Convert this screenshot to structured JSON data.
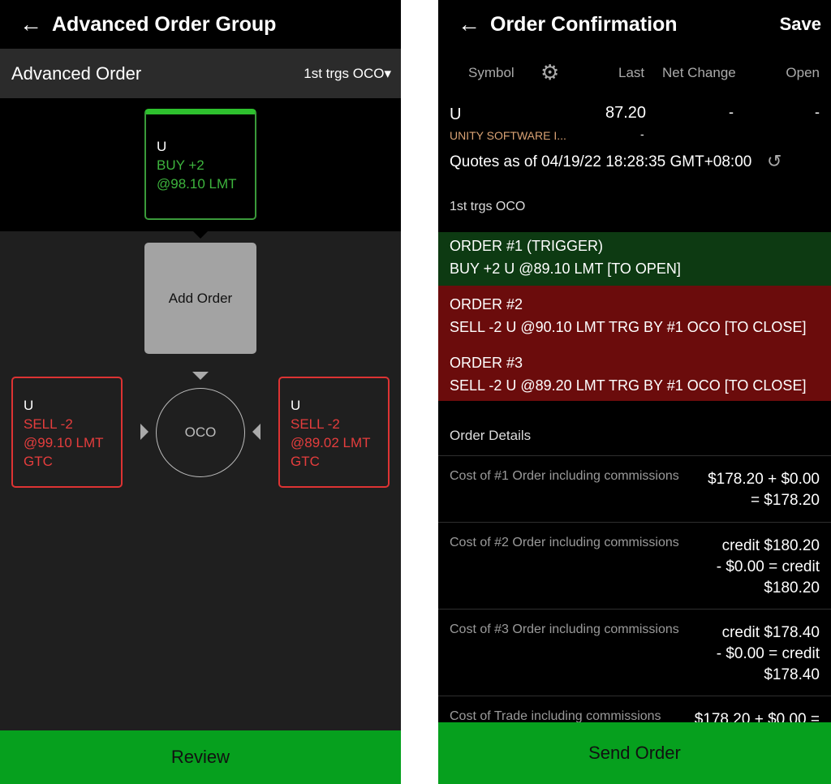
{
  "left": {
    "title": "Advanced Order Group",
    "subheader": {
      "label": "Advanced Order",
      "dropdown": "1st trgs OCO"
    },
    "trigger_order": {
      "symbol": "U",
      "action": "BUY +2",
      "price": "@98.10 LMT"
    },
    "add_order_label": "Add Order",
    "oco_label": "OCO",
    "oco_left": {
      "symbol": "U",
      "action": "SELL -2",
      "price": "@99.10 LMT",
      "tif": "GTC"
    },
    "oco_right": {
      "symbol": "U",
      "action": "SELL -2",
      "price": "@89.02 LMT",
      "tif": "GTC"
    },
    "review_label": "Review"
  },
  "right": {
    "title": "Order Confirmation",
    "save_label": "Save",
    "columns": [
      "Symbol",
      "Last",
      "Net Change",
      "Open"
    ],
    "quote": {
      "symbol": "U",
      "name": "UNITY SOFTWARE I...",
      "last": "87.20",
      "last_sub": "-",
      "net_change": "-",
      "open": "-"
    },
    "quotes_as_of": "Quotes as of 04/19/22 18:28:35 GMT+08:00",
    "group_type": "1st trgs OCO",
    "orders": [
      {
        "title": "ORDER #1 (TRIGGER)",
        "desc": "BUY +2 U @89.10 LMT [TO OPEN]"
      },
      {
        "title": "ORDER #2",
        "desc": "SELL -2 U @90.10 LMT TRG BY #1 OCO [TO CLOSE]"
      },
      {
        "title": "ORDER #3",
        "desc": "SELL -2 U @89.20 LMT TRG BY #1 OCO [TO CLOSE]"
      }
    ],
    "details_label": "Order Details",
    "costs": [
      {
        "label": "Cost of #1 Order including commissions",
        "value": "$178.20 + $0.00 = $178.20"
      },
      {
        "label": "Cost of #2 Order including commissions",
        "value": "credit $180.20 - $0.00 = credit $180.20"
      },
      {
        "label": "Cost of #3 Order including commissions",
        "value": "credit $178.40 - $0.00 = credit $178.40"
      },
      {
        "label": "Cost of Trade including commissions",
        "value": "$178.20 + $0.00 ="
      }
    ],
    "send_label": "Send Order"
  },
  "colors": {
    "green": "#06a01e",
    "buy": "#3db43d",
    "sell": "#e53d3d",
    "trigger_bg": "#0d3a12",
    "oco_bg": "#6b0c0c",
    "company": "#d9a274"
  }
}
